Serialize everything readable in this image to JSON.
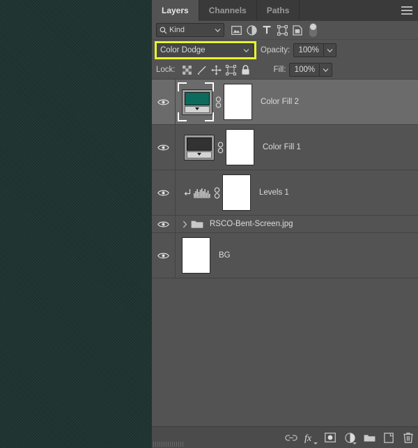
{
  "panel": {
    "tabs": [
      {
        "label": "Layers",
        "active": true
      },
      {
        "label": "Channels",
        "active": false
      },
      {
        "label": "Paths",
        "active": false
      }
    ],
    "menu_icon": "hamburger-menu-icon"
  },
  "filter": {
    "kind_label": "Kind",
    "search_icon": "magnifier-icon",
    "chevron_icon": "chevron-down-icon",
    "icons": [
      "image-filter-icon",
      "adjustment-filter-icon",
      "type-filter-icon",
      "shape-filter-icon",
      "smart-object-filter-icon",
      "filter-toggle-switch"
    ]
  },
  "blend": {
    "mode": "Color Dodge",
    "mode_chevron": "chevron-down-icon",
    "opacity_label": "Opacity:",
    "opacity_value": "100%",
    "opacity_chevron": "chevron-down-icon",
    "highlight_color": "#e8f52a"
  },
  "lock": {
    "label": "Lock:",
    "icons": [
      "lock-transparency-icon",
      "lock-image-brush-icon",
      "lock-position-move-icon",
      "lock-artboard-nesting-icon",
      "lock-all-padlock-icon"
    ],
    "fill_label": "Fill:",
    "fill_value": "100%",
    "fill_chevron": "chevron-down-icon"
  },
  "layers": [
    {
      "name": "Color Fill 2",
      "type": "fill",
      "selected": true,
      "visible": true,
      "eye_icon": "eye-visibility-icon",
      "link_icon": "link-layers-icon",
      "swatch_color": "#0d6b5c",
      "mask_color": "#ffffff"
    },
    {
      "name": "Color Fill 1",
      "type": "fill",
      "selected": false,
      "visible": true,
      "eye_icon": "eye-visibility-icon",
      "link_icon": "link-layers-icon",
      "swatch_color": "#323232",
      "mask_color": "#ffffff"
    },
    {
      "name": "Levels 1",
      "type": "adjustment",
      "selected": false,
      "visible": true,
      "eye_icon": "eye-visibility-icon",
      "clip_icon": "clipping-mask-arrow-icon",
      "adjust_icon": "levels-histogram-icon",
      "link_icon": "link-layers-icon",
      "mask_color": "#ffffff"
    },
    {
      "name": "RSCO-Bent-Screen.jpg",
      "type": "group",
      "selected": false,
      "visible": true,
      "eye_icon": "eye-visibility-icon",
      "expand_icon": "chevron-right-icon",
      "folder_icon": "folder-icon"
    },
    {
      "name": "BG",
      "type": "raster",
      "selected": false,
      "visible": true,
      "eye_icon": "eye-visibility-icon",
      "thumb_color": "#ffffff"
    }
  ],
  "bottom_bar": {
    "icons": [
      "link-layers-icon",
      "layer-fx-icon",
      "add-layer-mask-icon",
      "new-adjustment-layer-icon",
      "new-group-icon",
      "new-layer-icon",
      "delete-layer-icon"
    ]
  },
  "canvas": {
    "name": "document-artwork",
    "base_color": "#1e3330"
  }
}
